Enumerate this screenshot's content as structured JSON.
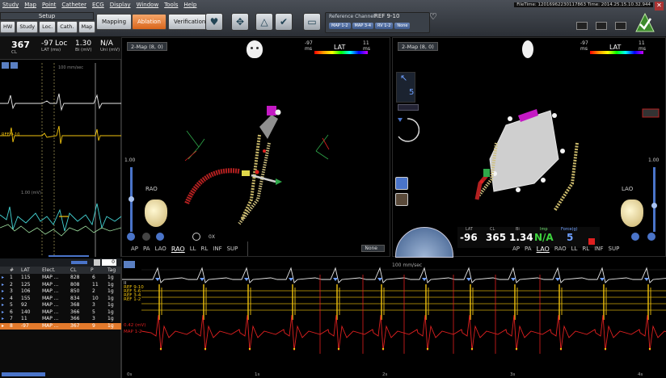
{
  "menu": [
    "Study",
    "Map",
    "Point",
    "Catheter",
    "ECG",
    "Display",
    "Window",
    "Tools",
    "Help"
  ],
  "setup": {
    "title": "Setup",
    "tabs": [
      "HW",
      "Study",
      "Loc.",
      "Cath.",
      "Map"
    ]
  },
  "modes": {
    "mapping": "Mapping",
    "ablation": "Ablation",
    "verification": "Verification"
  },
  "reference": {
    "label": "Reference Channel",
    "value": "REF 9-10",
    "channels": [
      "MAP 1-2",
      "MAP 3-4",
      "RV 1-2",
      "None"
    ]
  },
  "filetime": "FileTime: 12016962230117863 Time: 2014.25.15.10.32.944",
  "live": {
    "cl": "367",
    "cl_label": "CL",
    "lat": "-97",
    "lat_label": "LAT (ms)",
    "loc": "Loc",
    "bi": "1.30",
    "bi_label": "Bi (mV)",
    "uni": "N/A",
    "uni_label": "Uni (mV)"
  },
  "left_ecg": {
    "speed": "100 mm/sec",
    "labels": [
      "REF 9-10",
      "1.00 (mV)"
    ]
  },
  "map_left": {
    "selector": "2-Map (8, 0)",
    "scale_min": "-97 ms",
    "scale_max": "11 ms",
    "scale_label": "LAT",
    "orientation": "RAO",
    "slider_value": "1.00",
    "zoom": "0X",
    "views": [
      "AP",
      "PA",
      "LAO",
      "RAO",
      "LL",
      "RL",
      "INF",
      "SUP"
    ],
    "selected_view": "RAO",
    "none_label": "None"
  },
  "map_right": {
    "selector": "2-Map (8, 0)",
    "scale_min": "-97 ms",
    "scale_max": "11 ms",
    "scale_label": "LAT",
    "orientation": "LAO",
    "slider_value": "1.00",
    "tool_value": "5",
    "views": [
      "AP",
      "PA",
      "LAO",
      "RAO",
      "LL",
      "RL",
      "INF",
      "SUP"
    ],
    "selected_view": "LAO",
    "readout": {
      "lat": "-96",
      "lat_label": "LAT",
      "cl": "365",
      "cl_label": "CL",
      "bi": "1.34",
      "bi_label": "Bi",
      "imp": "N/A",
      "imp_label": "Imp",
      "force": "5",
      "force_label": "Force(g)"
    }
  },
  "point_list": {
    "count": "0",
    "headers": [
      "#",
      "LAT",
      "Elect.",
      "CL",
      "P",
      "Tag"
    ],
    "rows": [
      [
        "1",
        "115",
        "MAP ...",
        "828",
        "6",
        "1g"
      ],
      [
        "2",
        "125",
        "MAP ...",
        "808",
        "11",
        "1g"
      ],
      [
        "3",
        "106",
        "MAP ...",
        "850",
        "2",
        "1g"
      ],
      [
        "4",
        "155",
        "MAP ...",
        "834",
        "10",
        "1g"
      ],
      [
        "5",
        "92",
        "MAP ...",
        "368",
        "3",
        "1g"
      ],
      [
        "6",
        "140",
        "MAP ...",
        "366",
        "5",
        "1g"
      ],
      [
        "7",
        "11",
        "MAP ...",
        "366",
        "3",
        "1g"
      ],
      [
        "8",
        "-97",
        "MAP ...",
        "367",
        "9",
        "1g"
      ]
    ],
    "selected": 7
  },
  "bottom_ecg": {
    "speed": "100 mm/sec",
    "channel_labels": [
      "II",
      "REF 9-10",
      "REF 5-6",
      "REF 3-4",
      "REF 1-2",
      "0.42 (mV)",
      "MAP 1-2"
    ],
    "time_ticks": [
      "0s",
      "1s",
      "2s",
      "3s",
      "4s"
    ]
  },
  "colors": {
    "accent": "#e37a2c",
    "map_surface": "#c9c9c9",
    "ecg_red": "#e02020",
    "ecg_yellow": "#f2c40e",
    "ecg_white": "#e8e8e8"
  }
}
